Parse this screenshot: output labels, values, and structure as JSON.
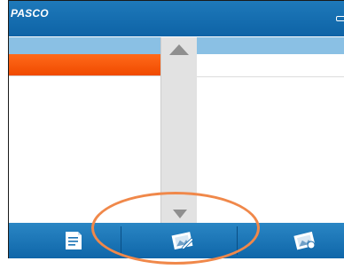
{
  "titlebar": {
    "brand": "PASCO"
  },
  "icons": {
    "battery": "battery-icon",
    "scroll_up": "triangle-up-icon",
    "scroll_down": "triangle-down-icon",
    "toolbar_1": "notes-page-icon",
    "toolbar_2": "edit-photo-icon",
    "toolbar_3": "photo-settings-icon"
  },
  "colors": {
    "titlebar": "#0e63a6",
    "header": "#8ac0e4",
    "selected_row": "#f04a00",
    "highlight_circle": "#f0884a"
  }
}
